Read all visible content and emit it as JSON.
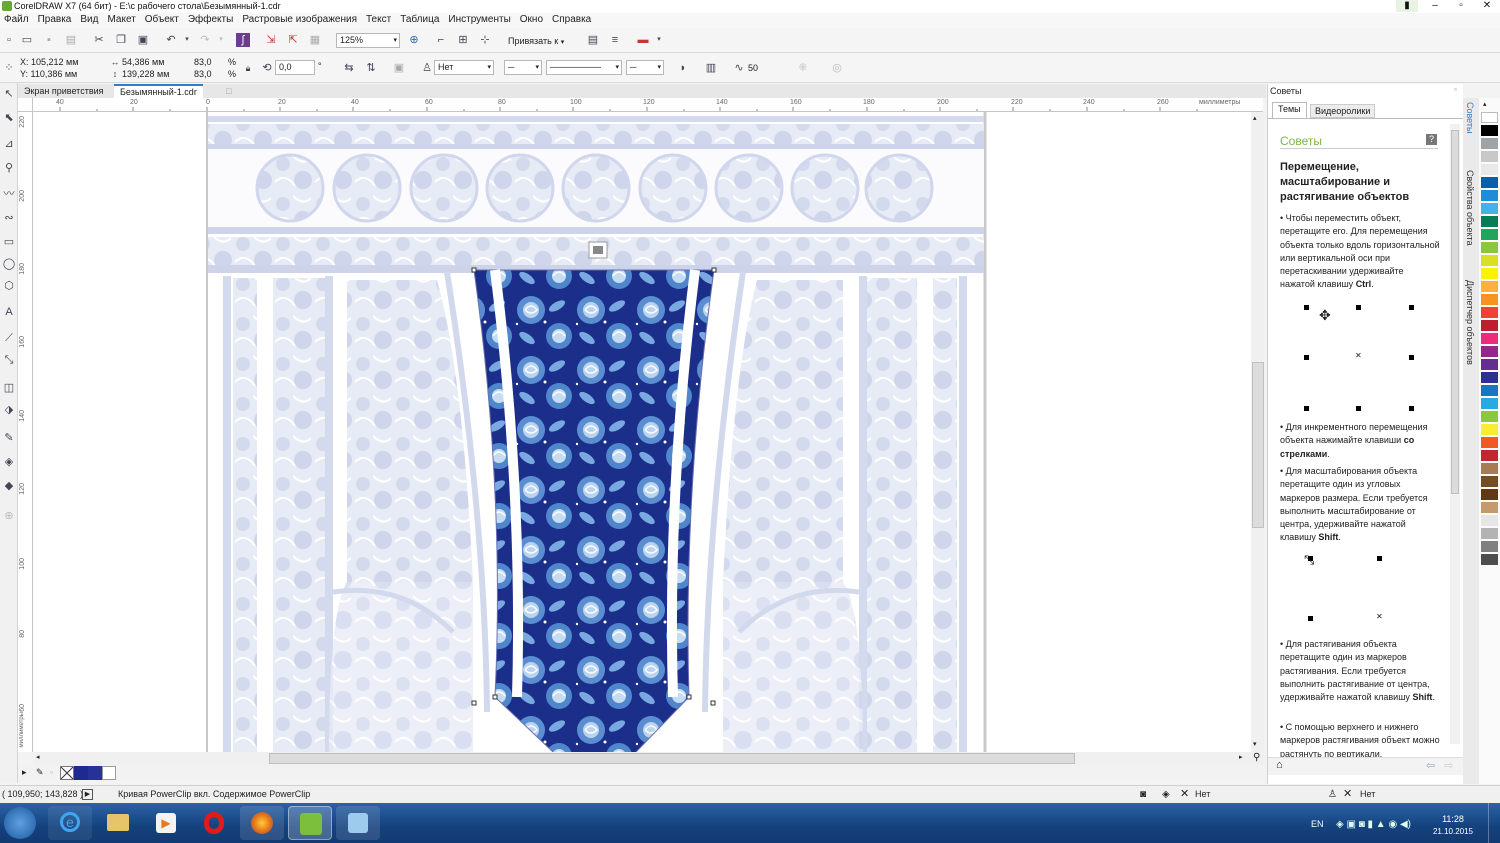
{
  "window": {
    "title": "CorelDRAW X7 (64 бит) - E:\\с рабочего стола\\Безымянный-1.cdr"
  },
  "menu": [
    "Файл",
    "Правка",
    "Вид",
    "Макет",
    "Объект",
    "Эффекты",
    "Растровые изображения",
    "Текст",
    "Таблица",
    "Инструменты",
    "Окно",
    "Справка"
  ],
  "standard_toolbar": {
    "zoom": "125%",
    "snap_label": "Привязать к"
  },
  "property_bar": {
    "x": "X: 105,212 мм",
    "y": "Y: 110,386 мм",
    "width": "54,386 мм",
    "height": "139,228 мм",
    "scale_x": "83,0",
    "scale_y": "83,0",
    "percent": "%",
    "rotation": "0,0",
    "degree": "°",
    "wrap": "Нет",
    "smoothing": "50"
  },
  "doc_tabs": [
    "Экран приветствия",
    "Безымянный-1.cdr"
  ],
  "ruler": {
    "h_ticks": [
      "40",
      "20",
      "0",
      "20",
      "40",
      "60",
      "80",
      "100",
      "120",
      "140",
      "160",
      "180",
      "200",
      "220",
      "240",
      "260"
    ],
    "h_units": "миллиметры",
    "v_ticks": [
      "220",
      "200",
      "180",
      "160",
      "140",
      "120",
      "100",
      "80",
      "60"
    ],
    "v_units": "миллиметры"
  },
  "docker": {
    "panel_title": "Советы",
    "tabs": [
      "Темы",
      "Видеоролики"
    ],
    "section_title": "Советы",
    "heading": "Перемещение, масштабирование и растягивание объектов",
    "tip1_a": "Чтобы переместить объект, перетащите его. Для перемещения объекта только вдоль горизонтальной или вертикальной оси при перетаскивании удерживайте нажатой клавишу ",
    "tip1_b": "Ctrl",
    "tip2_a": "Для инкрементного перемещения объекта нажимайте клавиши ",
    "tip2_b": "со стрелками",
    "tip3_a": "Для масштабирования объекта перетащите один из угловых маркеров размера. Если требуется выполнить масштабирование от центра, удерживайте нажатой клавишу ",
    "tip3_b": "Shift",
    "tip4_a": "Для растягивания объекта перетащите один из маркеров растягивания. Если требуется выполнить растягивание от центра, удерживайте нажатой клавишу ",
    "tip4_b": "Shift",
    "tip5": "С помощью верхнего и нижнего маркеров растягивания объект можно растянуть по вертикали."
  },
  "docker_side_tabs": [
    "Советы",
    "Свойства объекта",
    "Диспетчер объектов"
  ],
  "status": {
    "coords": "( 109,950; 143,828 )",
    "message": "Кривая PowerClip вкл. Содержимое PowerClip",
    "fill": "Нет",
    "outline": "Нет"
  },
  "taskbar": {
    "lang": "EN",
    "time": "11:28",
    "date": "21.10.2015"
  },
  "palette_colors": [
    "#ffffff",
    "#000000",
    "#9ea3a8",
    "#c8c8c8",
    "#e8e8e8",
    "#0b5ea8",
    "#1d8ed6",
    "#43b2e8",
    "#0a7b57",
    "#21a55d",
    "#8cc63f",
    "#d9e021",
    "#fff200",
    "#fcb040",
    "#f7941e",
    "#ef4136",
    "#be1e2d",
    "#ee2a7b",
    "#92278f",
    "#662d91",
    "#2e3192",
    "#1b75bc",
    "#27aae1",
    "#8dc63f",
    "#f9ed32",
    "#f15a24",
    "#c1272d",
    "#a67c52",
    "#754c24",
    "#603813",
    "#c49a6c",
    "#e6e6e6",
    "#b3b3b3",
    "#808080",
    "#4d4d4d"
  ]
}
